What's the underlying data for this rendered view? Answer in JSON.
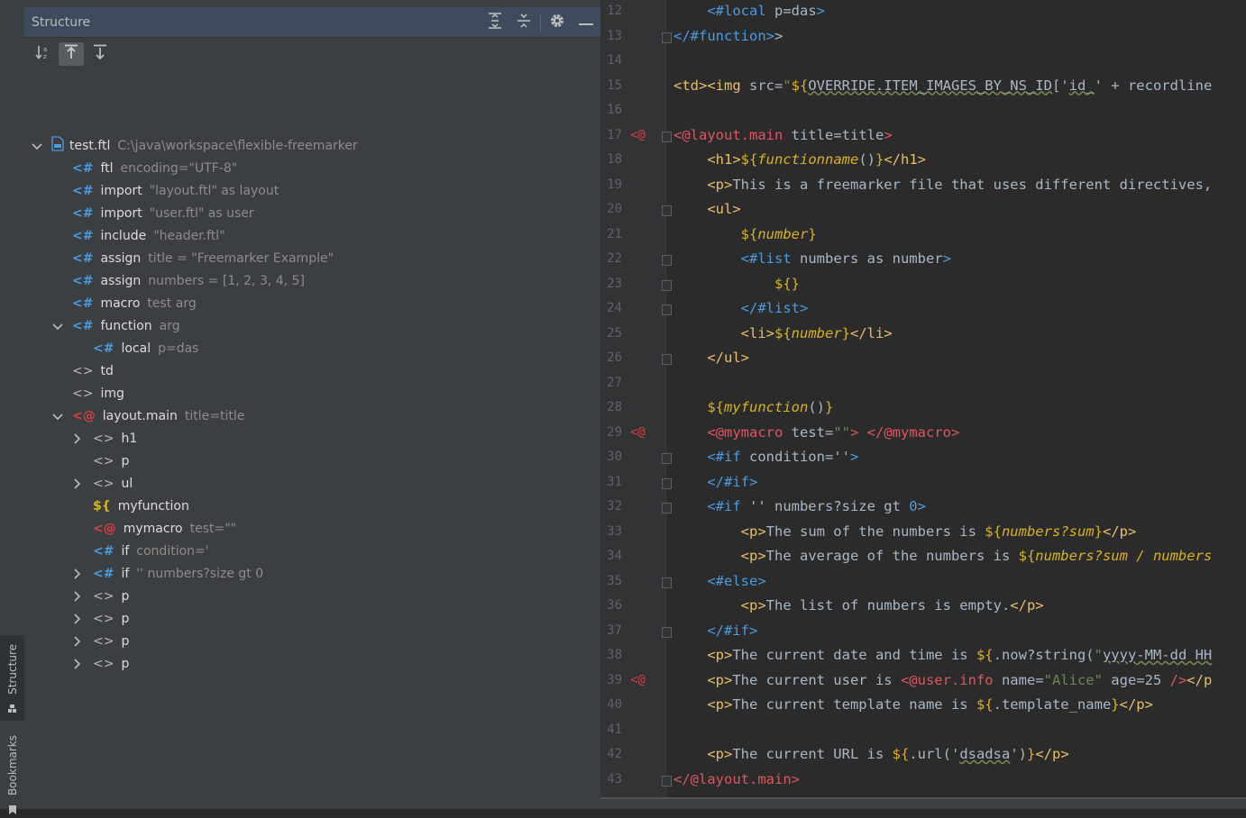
{
  "side_strip": {
    "structure_tab": "Structure",
    "bookmarks_tab": "Bookmarks"
  },
  "panel": {
    "title": "Structure",
    "header_icons": [
      "expand-all-icon",
      "collapse-all-icon",
      "gear-icon",
      "minimize-icon"
    ],
    "toolbar_icons": [
      "sort-alpha-icon",
      "navigate-from-source-icon",
      "navigate-to-source-icon"
    ]
  },
  "tree": [
    {
      "indent": 0,
      "chev": "down",
      "icon": "file",
      "name": "test.ftl",
      "detail": "C:\\java\\workspace\\flexible-freemarker"
    },
    {
      "indent": 1,
      "chev": "",
      "icon": "<#",
      "name": "ftl",
      "detail": "encoding=\"UTF-8\""
    },
    {
      "indent": 1,
      "chev": "",
      "icon": "<#",
      "name": "import",
      "detail": "\"layout.ftl\" as layout"
    },
    {
      "indent": 1,
      "chev": "",
      "icon": "<#",
      "name": "import",
      "detail": "\"user.ftl\" as user"
    },
    {
      "indent": 1,
      "chev": "",
      "icon": "<#",
      "name": "include",
      "detail": "\"header.ftl\""
    },
    {
      "indent": 1,
      "chev": "",
      "icon": "<#",
      "name": "assign",
      "detail": "title = \"Freemarker Example\""
    },
    {
      "indent": 1,
      "chev": "",
      "icon": "<#",
      "name": "assign",
      "detail": "numbers = [1, 2, 3, 4, 5]"
    },
    {
      "indent": 1,
      "chev": "",
      "icon": "<#",
      "name": "macro",
      "detail": "test arg"
    },
    {
      "indent": 1,
      "chev": "down",
      "icon": "<#",
      "name": "function",
      "detail": "arg"
    },
    {
      "indent": 2,
      "chev": "",
      "icon": "<#",
      "name": "local",
      "detail": "p=das"
    },
    {
      "indent": 1,
      "chev": "",
      "icon": "<>",
      "name": "td",
      "detail": ""
    },
    {
      "indent": 1,
      "chev": "",
      "icon": "<>",
      "name": "img",
      "detail": ""
    },
    {
      "indent": 1,
      "chev": "down",
      "icon": "<@",
      "name": "layout.main",
      "detail": "title=title"
    },
    {
      "indent": 2,
      "chev": "right",
      "icon": "<>",
      "name": "h1",
      "detail": ""
    },
    {
      "indent": 2,
      "chev": "",
      "icon": "<>",
      "name": "p",
      "detail": ""
    },
    {
      "indent": 2,
      "chev": "right",
      "icon": "<>",
      "name": "ul",
      "detail": ""
    },
    {
      "indent": 2,
      "chev": "",
      "icon": "${",
      "name": "myfunction",
      "detail": ""
    },
    {
      "indent": 2,
      "chev": "",
      "icon": "<@",
      "name": "mymacro",
      "detail": "test=\"\""
    },
    {
      "indent": 2,
      "chev": "",
      "icon": "<#",
      "name": "if",
      "detail": "condition='"
    },
    {
      "indent": 2,
      "chev": "right",
      "icon": "<#",
      "name": "if",
      "detail": "'' numbers?size gt 0"
    },
    {
      "indent": 2,
      "chev": "right",
      "icon": "<>",
      "name": "p",
      "detail": ""
    },
    {
      "indent": 2,
      "chev": "right",
      "icon": "<>",
      "name": "p",
      "detail": ""
    },
    {
      "indent": 2,
      "chev": "right",
      "icon": "<>",
      "name": "p",
      "detail": ""
    },
    {
      "indent": 2,
      "chev": "right",
      "icon": "<>",
      "name": "p",
      "detail": ""
    }
  ],
  "editor": {
    "line_numbers": [
      "12",
      "13",
      "14",
      "15",
      "16",
      "17",
      "18",
      "19",
      "20",
      "21",
      "22",
      "23",
      "24",
      "25",
      "26",
      "27",
      "28",
      "29",
      "30",
      "31",
      "32",
      "33",
      "34",
      "35",
      "36",
      "37",
      "38",
      "39",
      "40",
      "41",
      "42",
      "43"
    ],
    "gutter_marks": {
      "17": "<@",
      "29": "<@",
      "39": "<@"
    },
    "lines": [
      [
        [
          "ind",
          "    "
        ],
        [
          "ftl",
          "<#local"
        ],
        [
          "txt",
          " p=das"
        ],
        [
          "ftl",
          ">"
        ]
      ],
      [
        [
          "ftl",
          "</#function>"
        ],
        [
          "txt",
          ">"
        ]
      ],
      [],
      [
        [
          "tag",
          "<td><img "
        ],
        [
          "txt",
          "src="
        ],
        [
          "str",
          "\""
        ],
        [
          "dol",
          "${"
        ],
        [
          "ul",
          "OVERRIDE.ITEM_IMAGES_BY_NS_ID"
        ],
        [
          "txt",
          "['"
        ],
        [
          "ul",
          "id_"
        ],
        [
          "txt",
          "' + recordline"
        ]
      ],
      [],
      [
        [
          "at",
          "<@layout.main"
        ],
        [
          "txt",
          " title=title"
        ],
        [
          "at",
          ">"
        ]
      ],
      [
        [
          "ind",
          "    "
        ],
        [
          "tag",
          "<h1>"
        ],
        [
          "dol",
          "${"
        ],
        [
          "it",
          "functionname"
        ],
        [
          "txt",
          "()"
        ],
        [
          "dol",
          "}"
        ],
        [
          "tag",
          "</h1>"
        ]
      ],
      [
        [
          "ind",
          "    "
        ],
        [
          "tag",
          "<p>"
        ],
        [
          "txt",
          "This is a freemarker file that uses different directives,"
        ]
      ],
      [
        [
          "ind",
          "    "
        ],
        [
          "tag",
          "<ul>"
        ]
      ],
      [
        [
          "ind",
          "        "
        ],
        [
          "dol",
          "${"
        ],
        [
          "it",
          "number"
        ],
        [
          "dol",
          "}"
        ]
      ],
      [
        [
          "ind",
          "        "
        ],
        [
          "ftl",
          "<#list"
        ],
        [
          "txt",
          " numbers as number"
        ],
        [
          "ftl",
          ">"
        ]
      ],
      [
        [
          "ind",
          "            "
        ],
        [
          "dol",
          "${}"
        ]
      ],
      [
        [
          "ind",
          "        "
        ],
        [
          "ftl",
          "</#list>"
        ]
      ],
      [
        [
          "ind",
          "        "
        ],
        [
          "tag",
          "<li>"
        ],
        [
          "dol",
          "${"
        ],
        [
          "it",
          "number"
        ],
        [
          "dol",
          "}"
        ],
        [
          "tag",
          "</li>"
        ]
      ],
      [
        [
          "ind",
          "    "
        ],
        [
          "tag",
          "</ul>"
        ]
      ],
      [],
      [
        [
          "ind",
          "    "
        ],
        [
          "dol",
          "${"
        ],
        [
          "it",
          "myfunction"
        ],
        [
          "txt",
          "()"
        ],
        [
          "dol",
          "}"
        ]
      ],
      [
        [
          "ind",
          "    "
        ],
        [
          "at",
          "<@mymacro"
        ],
        [
          "txt",
          " test="
        ],
        [
          "str",
          "\"\""
        ],
        [
          "at",
          "> </@mymacro>"
        ]
      ],
      [
        [
          "ind",
          "    "
        ],
        [
          "ftl",
          "<#if"
        ],
        [
          "txt",
          " condition=''"
        ],
        [
          "ftl",
          ">"
        ]
      ],
      [
        [
          "ind",
          "    "
        ],
        [
          "ftl",
          "</#if>"
        ]
      ],
      [
        [
          "ind",
          "    "
        ],
        [
          "ftl",
          "<#if"
        ],
        [
          "txt",
          " '' numbers?size gt "
        ],
        [
          "ftl",
          "0>"
        ]
      ],
      [
        [
          "ind",
          "        "
        ],
        [
          "tag",
          "<p>"
        ],
        [
          "txt",
          "The sum of the numbers is "
        ],
        [
          "dol",
          "${"
        ],
        [
          "it",
          "numbers?sum"
        ],
        [
          "dol",
          "}"
        ],
        [
          "tag",
          "</p>"
        ]
      ],
      [
        [
          "ind",
          "        "
        ],
        [
          "tag",
          "<p>"
        ],
        [
          "txt",
          "The average of the numbers is "
        ],
        [
          "dol",
          "${"
        ],
        [
          "it",
          "numbers?sum / numbers"
        ]
      ],
      [
        [
          "ind",
          "    "
        ],
        [
          "ftl",
          "<#else>"
        ]
      ],
      [
        [
          "ind",
          "        "
        ],
        [
          "tag",
          "<p>"
        ],
        [
          "txt",
          "The list of numbers is empty."
        ],
        [
          "tag",
          "</p>"
        ]
      ],
      [
        [
          "ind",
          "    "
        ],
        [
          "ftl",
          "</#if>"
        ]
      ],
      [
        [
          "ind",
          "    "
        ],
        [
          "tag",
          "<p>"
        ],
        [
          "txt",
          "The current date and time is "
        ],
        [
          "dol",
          "${"
        ],
        [
          "txt",
          ".now?string("
        ],
        [
          "str",
          "\""
        ],
        [
          "ul",
          "yyyy-MM-dd HH"
        ]
      ],
      [
        [
          "ind",
          "    "
        ],
        [
          "tag",
          "<p>"
        ],
        [
          "txt",
          "The current user is "
        ],
        [
          "at",
          "<@user.info"
        ],
        [
          "txt",
          " name="
        ],
        [
          "str",
          "\"Alice\""
        ],
        [
          "txt",
          " age=25 "
        ],
        [
          "at",
          "/>"
        ],
        [
          "tag",
          "</p"
        ]
      ],
      [
        [
          "ind",
          "    "
        ],
        [
          "tag",
          "<p>"
        ],
        [
          "txt",
          "The current template name is "
        ],
        [
          "dol",
          "${"
        ],
        [
          "txt",
          ".template_name"
        ],
        [
          "dol",
          "}"
        ],
        [
          "tag",
          "</p>"
        ]
      ],
      [],
      [
        [
          "ind",
          "    "
        ],
        [
          "tag",
          "<p>"
        ],
        [
          "txt",
          "The current URL is "
        ],
        [
          "dol",
          "${"
        ],
        [
          "txt",
          ".url('"
        ],
        [
          "ul",
          "dsadsa"
        ],
        [
          "txt",
          "')"
        ],
        [
          "dol",
          "}"
        ],
        [
          "tag",
          "</p>"
        ]
      ],
      [
        [
          "at",
          "</@layout.main>"
        ]
      ]
    ],
    "fold_lines": [
      "13",
      "17",
      "20",
      "22",
      "23",
      "24",
      "26",
      "30",
      "31",
      "32",
      "35",
      "37",
      "43"
    ]
  }
}
